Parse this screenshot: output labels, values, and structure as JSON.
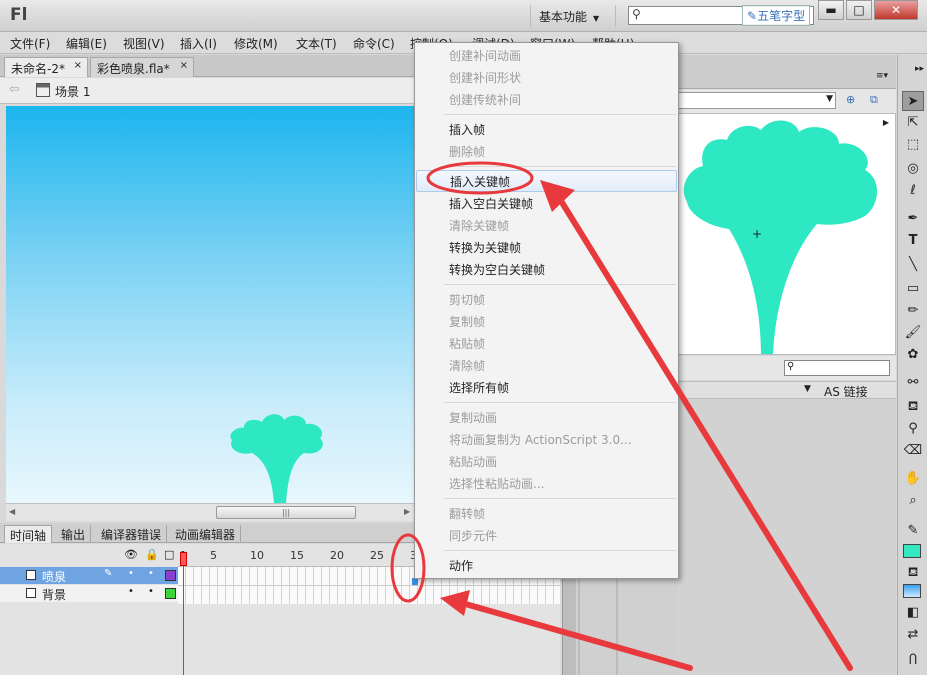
{
  "app": {
    "logo": "Fl",
    "workspace": "基本功能",
    "watermark": "五笔字型"
  },
  "window_controls": {
    "minimize": "▬",
    "maximize": "□",
    "close": "✕"
  },
  "menubar": [
    "文件(F)",
    "编辑(E)",
    "视图(V)",
    "插入(I)",
    "修改(M)",
    "文本(T)",
    "命令(C)",
    "控制(O)",
    "调试(D)",
    "窗口(W)",
    "帮助(H)"
  ],
  "doc_tabs": [
    {
      "label": "未命名-2*",
      "close": "×"
    },
    {
      "label": "彩色喷泉.fla*",
      "close": "×"
    }
  ],
  "scene": {
    "label": "场景 1"
  },
  "timeline": {
    "tabs": [
      "时间轴",
      "输出",
      "编译器错误",
      "动画编辑器"
    ],
    "ruler": [
      "1",
      "5",
      "10",
      "15",
      "20",
      "25",
      "30"
    ],
    "layers": [
      {
        "name": "喷泉",
        "color": "#8a3fd1"
      },
      {
        "name": "背景",
        "color": "#3ad63a"
      }
    ]
  },
  "context_menu": {
    "items": [
      {
        "label": "创建补间动画",
        "disabled": true
      },
      {
        "label": "创建补间形状",
        "disabled": true
      },
      {
        "label": "创建传统补间",
        "disabled": true
      },
      {
        "label": "插入帧",
        "disabled": false
      },
      {
        "label": "删除帧",
        "disabled": true
      },
      {
        "label": "插入关键帧",
        "disabled": false,
        "highlighted": true
      },
      {
        "label": "插入空白关键帧",
        "disabled": false
      },
      {
        "label": "清除关键帧",
        "disabled": true
      },
      {
        "label": "转换为关键帧",
        "disabled": false
      },
      {
        "label": "转换为空白关键帧",
        "disabled": false
      },
      {
        "label": "剪切帧",
        "disabled": true
      },
      {
        "label": "复制帧",
        "disabled": true
      },
      {
        "label": "粘贴帧",
        "disabled": true
      },
      {
        "label": "清除帧",
        "disabled": true
      },
      {
        "label": "选择所有帧",
        "disabled": false
      },
      {
        "label": "复制动画",
        "disabled": true
      },
      {
        "label": "将动画复制为 ActionScript 3.0...",
        "disabled": true
      },
      {
        "label": "粘贴动画",
        "disabled": true
      },
      {
        "label": "选择性粘贴动画...",
        "disabled": true
      },
      {
        "label": "翻转帧",
        "disabled": true
      },
      {
        "label": "同步元件",
        "disabled": true
      },
      {
        "label": "动作",
        "disabled": false
      }
    ]
  },
  "library": {
    "as_linkage_label": "AS 链接"
  },
  "colors": {
    "fountain": "#2ee8c4",
    "annotation": "#e8393c",
    "stroke_swatch": "#33e8c0"
  }
}
